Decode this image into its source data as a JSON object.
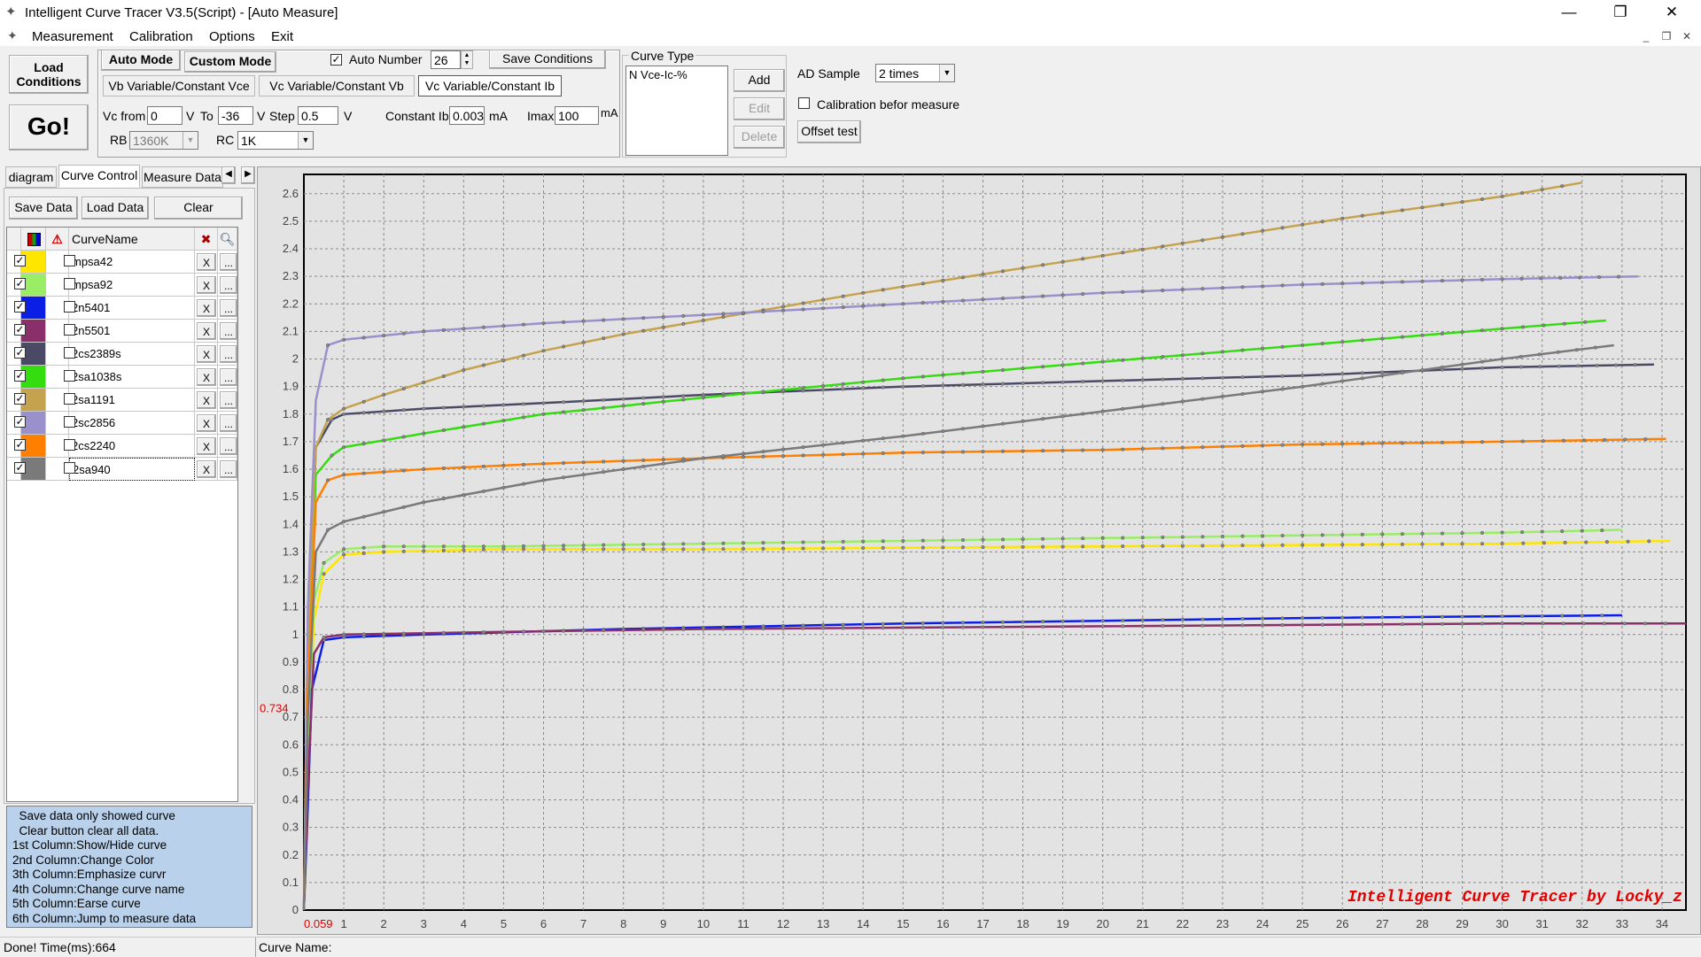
{
  "window": {
    "title": "Intelligent Curve Tracer V3.5(Script) - [Auto Measure]",
    "minimize_glyph": "—",
    "restore_glyph": "❐",
    "close_glyph": "✕",
    "app_icon": "curve-tracer-icon"
  },
  "menu": [
    "Measurement",
    "Calibration",
    "Options",
    "Exit"
  ],
  "mdi_controls": [
    "_",
    "❐",
    "✕"
  ],
  "toolbar": {
    "load_conditions": "Load Conditions",
    "go": "Go!",
    "auto_mode": "Auto Mode",
    "custom_mode": "Custom Mode",
    "auto_number_label": "Auto Number",
    "auto_number_value": "26",
    "save_conditions": "Save Conditions",
    "mode_tabs": [
      "Vb Variable/Constant Vce",
      "Vc Variable/Constant Vb",
      "Vc Variable/Constant Ib"
    ],
    "vc_from_label": "Vc from",
    "vc_from_value": "0",
    "v_unit": "V",
    "to_label": "To",
    "to_value": "-36",
    "step_label": "Step",
    "step_value": "0.5",
    "constant_ib_label": "Constant Ib",
    "constant_ib_value": "0.003",
    "ma_unit": "mA",
    "imax_label": "Imax",
    "imax_value": "100",
    "imax_unit": "mA",
    "rb_label": "RB",
    "rb_value": "1360K",
    "rc_label": "RC",
    "rc_value": "1K"
  },
  "curve_type": {
    "legend": "Curve Type",
    "items": [
      "N Vce-Ic-%"
    ],
    "add": "Add",
    "edit": "Edit",
    "delete": "Delete"
  },
  "ad": {
    "label": "AD Sample",
    "value": "2 times",
    "calibration_label": "Calibration befor measure",
    "offset_test": "Offset test"
  },
  "left_tabs": [
    "diagram",
    "Curve Control",
    "Measure Data"
  ],
  "data_buttons": {
    "save": "Save Data",
    "load": "Load Data",
    "clear": "Clear"
  },
  "grid": {
    "header_name": "CurveName",
    "x_label": "X",
    "dots_label": "...",
    "rows": [
      {
        "name": "mpsa42",
        "color": "#ffe600"
      },
      {
        "name": "mpsa92",
        "color": "#99ee66"
      },
      {
        "name": "2n5401",
        "color": "#0a1ee6"
      },
      {
        "name": "2n5501",
        "color": "#8b2f6b"
      },
      {
        "name": "2cs2389s",
        "color": "#4a4a66"
      },
      {
        "name": "2sa1038s",
        "color": "#33dd10"
      },
      {
        "name": "2sa1191",
        "color": "#c4a24e"
      },
      {
        "name": "2sc2856",
        "color": "#9a90cc"
      },
      {
        "name": "2cs2240",
        "color": "#ff8000"
      },
      {
        "name": "2sa940",
        "color": "#7a7a7a"
      }
    ]
  },
  "help": [
    "  Save data only showed curve",
    "  Clear button clear all data.",
    "1st Column:Show/Hide curve",
    "2nd Column:Change Color",
    "3th Column:Emphasize curvr",
    "4th Column:Change curve name",
    "5th Column:Earse curve",
    "6th Column:Jump to measure data"
  ],
  "status": {
    "left": "Done!  Time(ms):664",
    "curve_name_label": "Curve Name:"
  },
  "chart_data": {
    "type": "line",
    "watermark": "Intelligent Curve Tracer by Locky_z",
    "cursor_y_label": "0.734",
    "cursor_x_label": "0.059",
    "xlim": [
      0,
      34.6
    ],
    "ylim": [
      0,
      2.67
    ],
    "x_ticks": [
      1,
      2,
      3,
      4,
      5,
      6,
      7,
      8,
      9,
      10,
      11,
      12,
      13,
      14,
      15,
      16,
      17,
      18,
      19,
      20,
      21,
      22,
      23,
      24,
      25,
      26,
      27,
      28,
      29,
      30,
      31,
      32,
      33,
      34
    ],
    "y_ticks": [
      0.1,
      0.2,
      0.3,
      0.4,
      0.5,
      0.6,
      0.7,
      0.8,
      0.9,
      1,
      1.1,
      1.2,
      1.3,
      1.4,
      1.5,
      1.6,
      1.7,
      1.8,
      1.9,
      2,
      2.1,
      2.2,
      2.3,
      2.4,
      2.5,
      2.6
    ],
    "y_tick_labels": [
      "0",
      "0.1",
      "0.2",
      "0.3",
      "0.4",
      "0.5",
      "0.6",
      "0.7",
      "0.8",
      "0.9",
      "1",
      "1.1",
      "1.2",
      "1.3",
      "1.4",
      "1.5",
      "1.6",
      "1.7",
      "1.8",
      "1.9",
      "2",
      "2.1",
      "2.2",
      "2.3",
      "2.4",
      "2.5",
      "2.6"
    ],
    "grid": true,
    "series": [
      {
        "name": "mpsa42",
        "color": "#ffe600",
        "points": [
          [
            0,
            0
          ],
          [
            0.1,
            0.5
          ],
          [
            0.25,
            1.05
          ],
          [
            0.5,
            1.22
          ],
          [
            1,
            1.29
          ],
          [
            2,
            1.3
          ],
          [
            5,
            1.31
          ],
          [
            10,
            1.31
          ],
          [
            20,
            1.32
          ],
          [
            30,
            1.33
          ],
          [
            34.2,
            1.34
          ]
        ]
      },
      {
        "name": "mpsa92",
        "color": "#99ee66",
        "points": [
          [
            0,
            0
          ],
          [
            0.1,
            0.6
          ],
          [
            0.25,
            1.12
          ],
          [
            0.5,
            1.26
          ],
          [
            1,
            1.31
          ],
          [
            2,
            1.32
          ],
          [
            5,
            1.32
          ],
          [
            10,
            1.33
          ],
          [
            20,
            1.35
          ],
          [
            30,
            1.37
          ],
          [
            33,
            1.38
          ]
        ]
      },
      {
        "name": "2n5401",
        "color": "#0a1ee6",
        "points": [
          [
            0,
            0
          ],
          [
            0.08,
            0.3
          ],
          [
            0.2,
            0.8
          ],
          [
            0.5,
            0.98
          ],
          [
            1,
            0.99
          ],
          [
            3,
            1.0
          ],
          [
            8,
            1.02
          ],
          [
            15,
            1.04
          ],
          [
            25,
            1.06
          ],
          [
            33,
            1.07
          ]
        ]
      },
      {
        "name": "2n5501",
        "color": "#8b2f6b",
        "points": [
          [
            0,
            0
          ],
          [
            0.1,
            0.45
          ],
          [
            0.25,
            0.93
          ],
          [
            0.5,
            0.99
          ],
          [
            1,
            1.0
          ],
          [
            5,
            1.01
          ],
          [
            10,
            1.02
          ],
          [
            20,
            1.03
          ],
          [
            30,
            1.04
          ],
          [
            34.6,
            1.04
          ]
        ]
      },
      {
        "name": "2cs2389s",
        "color": "#4a4a66",
        "points": [
          [
            0,
            0
          ],
          [
            0.1,
            0.9
          ],
          [
            0.3,
            1.68
          ],
          [
            0.7,
            1.78
          ],
          [
            1,
            1.8
          ],
          [
            3,
            1.82
          ],
          [
            6,
            1.84
          ],
          [
            10,
            1.87
          ],
          [
            15,
            1.9
          ],
          [
            20,
            1.92
          ],
          [
            25,
            1.94
          ],
          [
            30,
            1.97
          ],
          [
            33.8,
            1.98
          ]
        ]
      },
      {
        "name": "2sa1038s",
        "color": "#33dd10",
        "points": [
          [
            0,
            0
          ],
          [
            0.1,
            0.9
          ],
          [
            0.3,
            1.58
          ],
          [
            0.7,
            1.65
          ],
          [
            1,
            1.68
          ],
          [
            3,
            1.73
          ],
          [
            6,
            1.8
          ],
          [
            10,
            1.86
          ],
          [
            15,
            1.93
          ],
          [
            20,
            1.99
          ],
          [
            25,
            2.05
          ],
          [
            30,
            2.11
          ],
          [
            32.6,
            2.14
          ]
        ]
      },
      {
        "name": "2sa1191",
        "color": "#c4a24e",
        "points": [
          [
            0,
            0
          ],
          [
            0.1,
            1.0
          ],
          [
            0.3,
            1.68
          ],
          [
            0.6,
            1.78
          ],
          [
            1,
            1.82
          ],
          [
            2,
            1.87
          ],
          [
            4,
            1.96
          ],
          [
            6,
            2.03
          ],
          [
            8,
            2.09
          ],
          [
            10,
            2.14
          ],
          [
            14,
            2.24
          ],
          [
            18,
            2.33
          ],
          [
            22,
            2.42
          ],
          [
            26,
            2.51
          ],
          [
            30,
            2.59
          ],
          [
            32,
            2.64
          ]
        ]
      },
      {
        "name": "2sc2856",
        "color": "#9a90cc",
        "points": [
          [
            0,
            0
          ],
          [
            0.1,
            1.1
          ],
          [
            0.3,
            1.85
          ],
          [
            0.6,
            2.05
          ],
          [
            1,
            2.07
          ],
          [
            3,
            2.1
          ],
          [
            6,
            2.13
          ],
          [
            10,
            2.16
          ],
          [
            15,
            2.2
          ],
          [
            20,
            2.24
          ],
          [
            25,
            2.27
          ],
          [
            30,
            2.29
          ],
          [
            33.4,
            2.3
          ]
        ]
      },
      {
        "name": "2cs2240",
        "color": "#ff8000",
        "points": [
          [
            0,
            0
          ],
          [
            0.1,
            0.8
          ],
          [
            0.3,
            1.48
          ],
          [
            0.6,
            1.56
          ],
          [
            1,
            1.58
          ],
          [
            3,
            1.6
          ],
          [
            6,
            1.62
          ],
          [
            10,
            1.64
          ],
          [
            15,
            1.66
          ],
          [
            20,
            1.67
          ],
          [
            25,
            1.69
          ],
          [
            30,
            1.7
          ],
          [
            34.1,
            1.71
          ]
        ]
      },
      {
        "name": "2sa940",
        "color": "#7a7a7a",
        "points": [
          [
            0,
            0
          ],
          [
            0.1,
            0.7
          ],
          [
            0.3,
            1.3
          ],
          [
            0.6,
            1.38
          ],
          [
            1,
            1.41
          ],
          [
            3,
            1.48
          ],
          [
            6,
            1.56
          ],
          [
            10,
            1.64
          ],
          [
            15,
            1.72
          ],
          [
            20,
            1.81
          ],
          [
            25,
            1.9
          ],
          [
            30,
            2.0
          ],
          [
            32.8,
            2.05
          ]
        ]
      }
    ]
  }
}
